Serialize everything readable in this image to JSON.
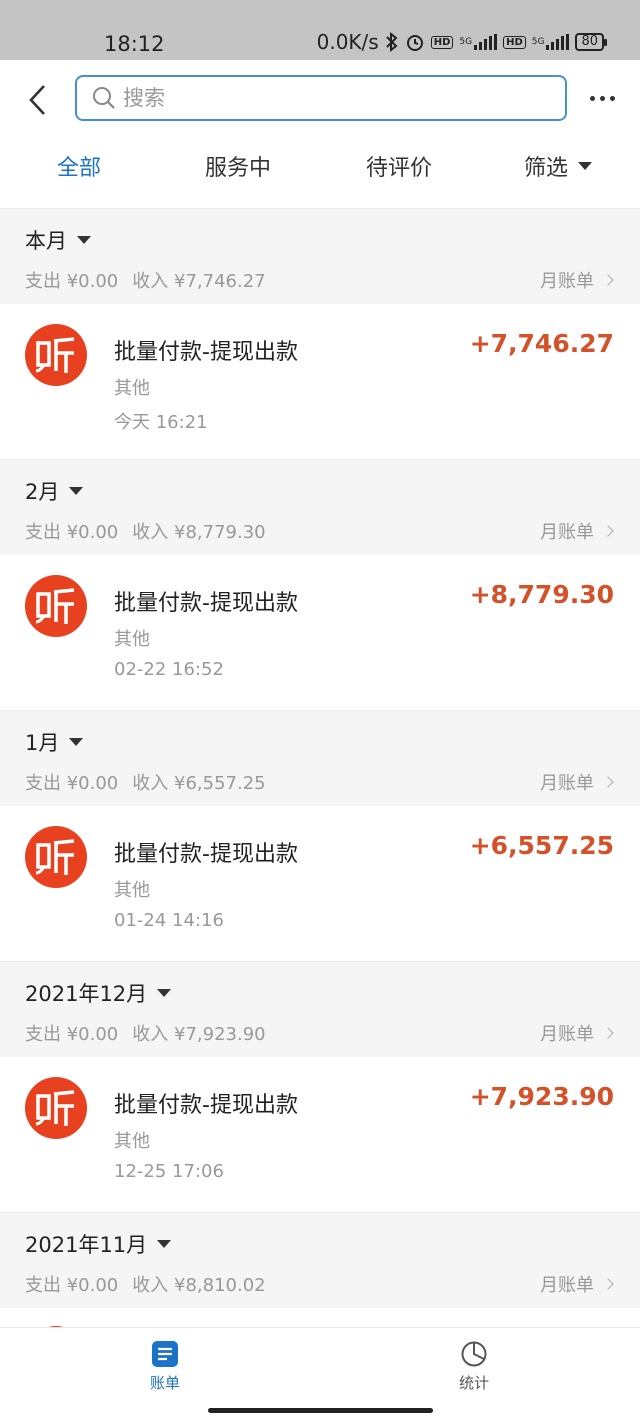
{
  "status_bar": {
    "time": "18:12",
    "net_speed": "0.0K/s",
    "hd1": "HD",
    "net1": "5G",
    "hd2": "HD",
    "net2": "5G",
    "battery": "80"
  },
  "search": {
    "placeholder": "搜索"
  },
  "tabs": [
    {
      "label": "全部",
      "active": true
    },
    {
      "label": "服务中"
    },
    {
      "label": "待评价"
    },
    {
      "label": "筛选"
    }
  ],
  "months": [
    {
      "title": "本月",
      "expense": "支出 ¥0.00",
      "income": "收入 ¥7,746.27",
      "bill_label": "月账单",
      "tx": {
        "title": "批量付款-提现出款",
        "category": "其他",
        "time": "今天 16:21",
        "amount": "+7,746.27"
      }
    },
    {
      "title": "2月",
      "expense": "支出 ¥0.00",
      "income": "收入 ¥8,779.30",
      "bill_label": "月账单",
      "tx": {
        "title": "批量付款-提现出款",
        "category": "其他",
        "time": "02-22 16:52",
        "amount": "+8,779.30"
      }
    },
    {
      "title": "1月",
      "expense": "支出 ¥0.00",
      "income": "收入 ¥6,557.25",
      "bill_label": "月账单",
      "tx": {
        "title": "批量付款-提现出款",
        "category": "其他",
        "time": "01-24 14:16",
        "amount": "+6,557.25"
      }
    },
    {
      "title": "2021年12月",
      "expense": "支出 ¥0.00",
      "income": "收入 ¥7,923.90",
      "bill_label": "月账单",
      "tx": {
        "title": "批量付款-提现出款",
        "category": "其他",
        "time": "12-25 17:06",
        "amount": "+7,923.90"
      }
    },
    {
      "title": "2021年11月",
      "expense": "支出 ¥0.00",
      "income": "收入 ¥8,810.02",
      "bill_label": "月账单"
    }
  ],
  "bottom_nav": [
    {
      "label": "账单",
      "icon": "bill-icon",
      "active": true
    },
    {
      "label": "统计",
      "icon": "stats-icon"
    }
  ],
  "colors": {
    "accent": "#1a73c8",
    "amount": "#d4522a",
    "logo": "#e8411f"
  }
}
